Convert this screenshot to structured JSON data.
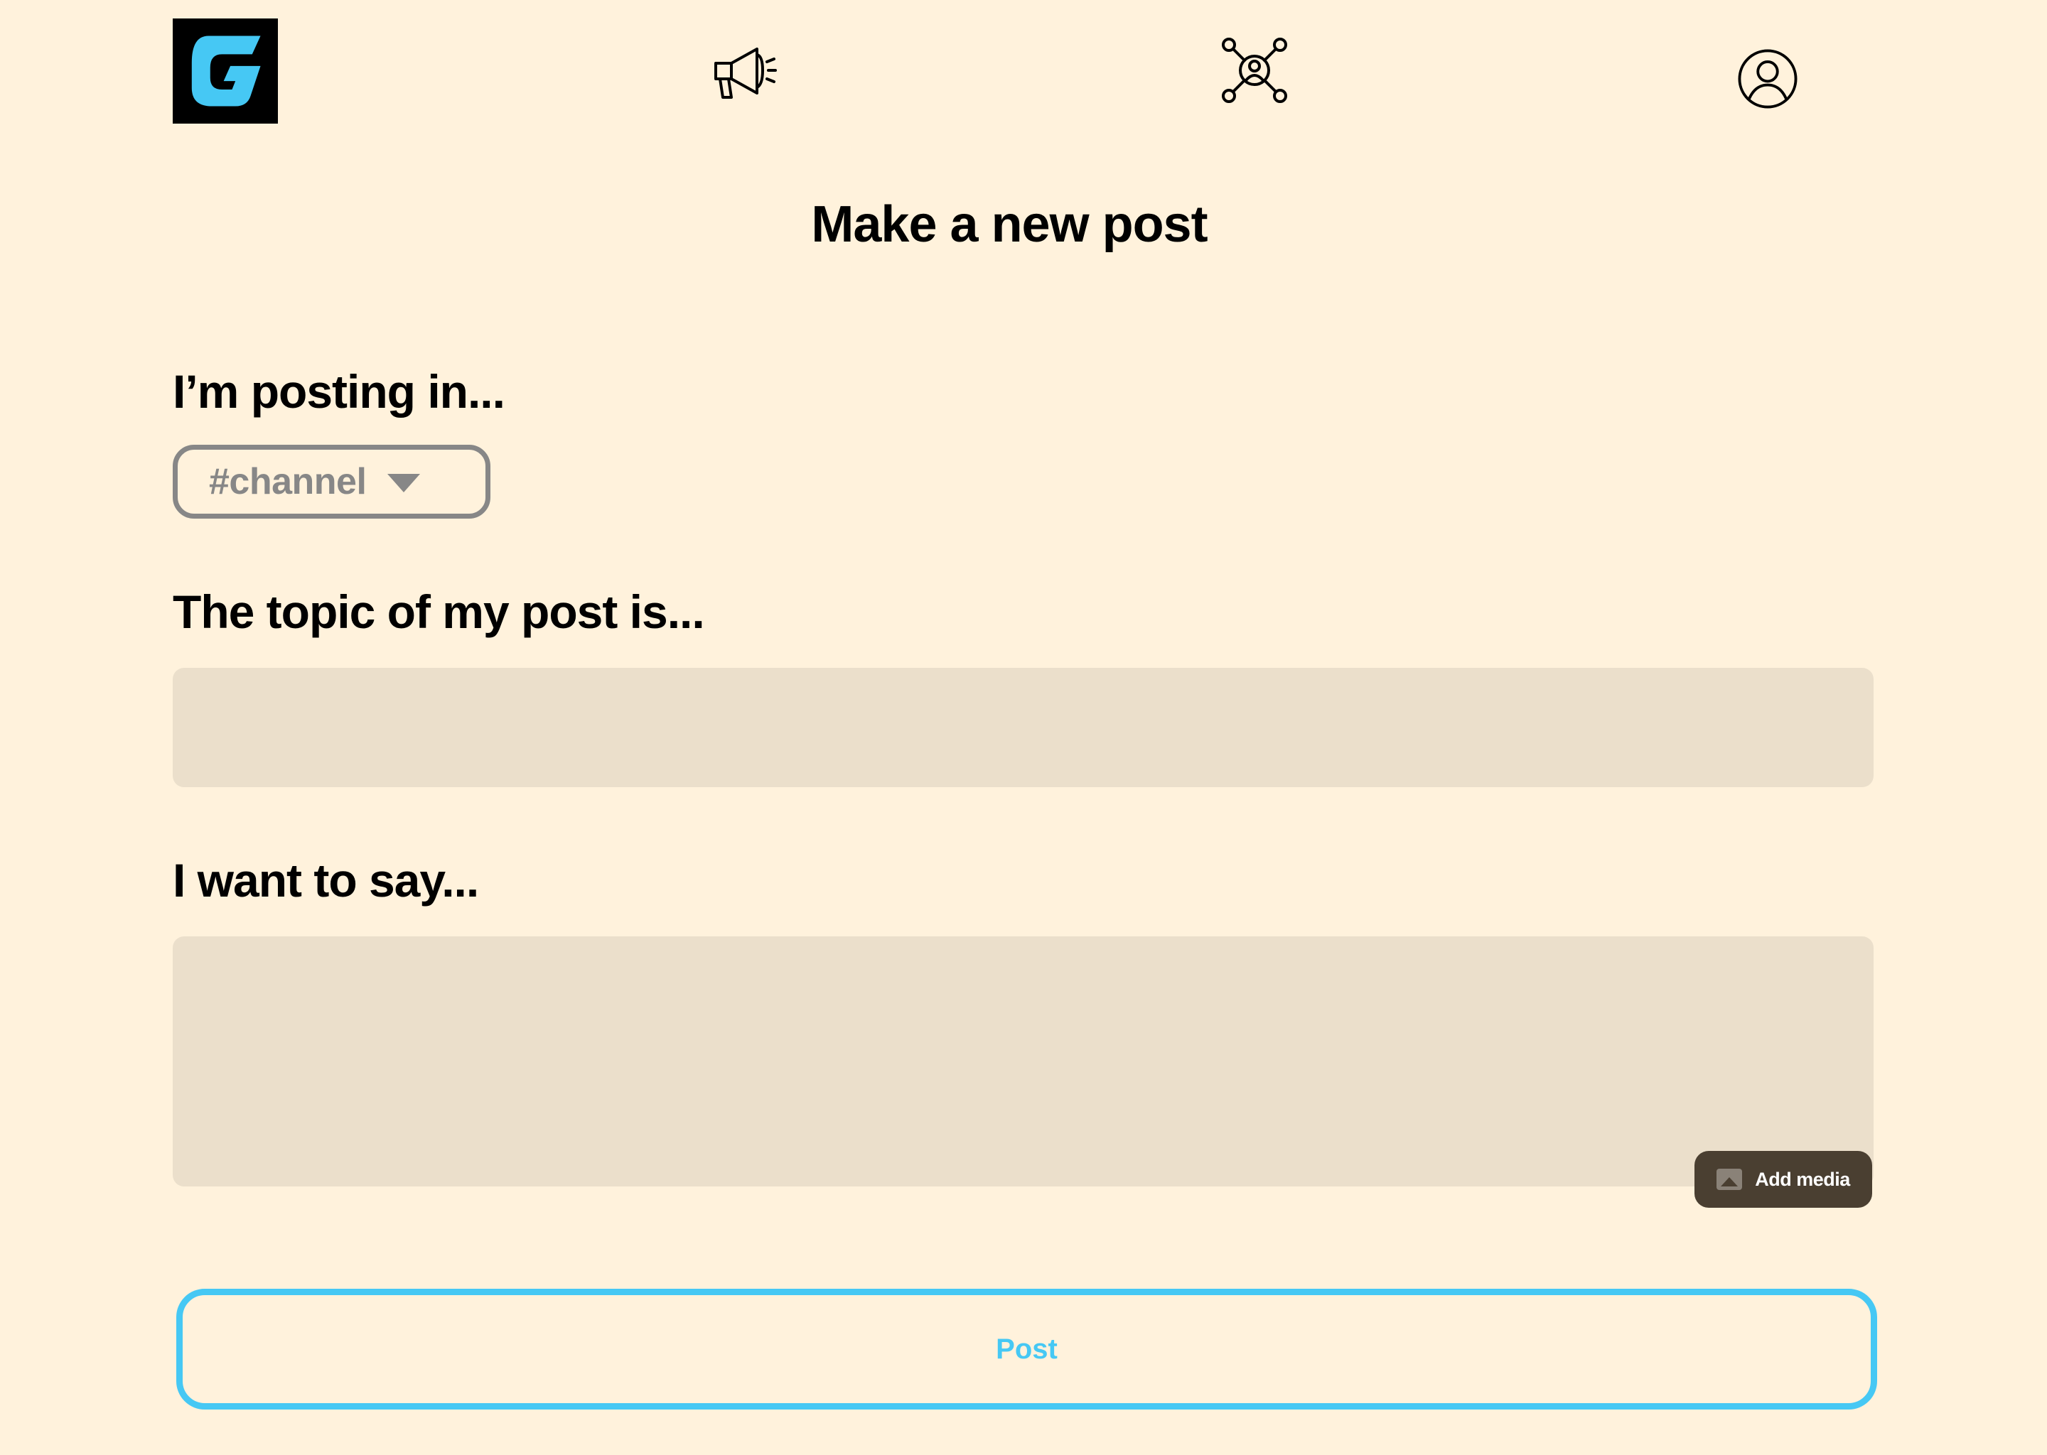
{
  "colors": {
    "background": "#fff2dc",
    "input_fill": "#ebdfcb",
    "accent": "#46c8f4",
    "muted": "#878787",
    "media_button": "#4a3f31",
    "logo_bg": "#000000"
  },
  "nav": {
    "logo_icon": "g-logo-icon",
    "items": [
      {
        "icon": "megaphone-icon"
      },
      {
        "icon": "network-icon"
      },
      {
        "icon": "profile-icon"
      }
    ]
  },
  "page": {
    "title": "Make a new post"
  },
  "form": {
    "channel_label": "I’m posting in...",
    "channel_value": "#channel",
    "topic_label": "The topic of my post is...",
    "topic_value": "",
    "say_label": "I want to say...",
    "say_value": "",
    "add_media_label": "Add media",
    "post_label": "Post"
  }
}
